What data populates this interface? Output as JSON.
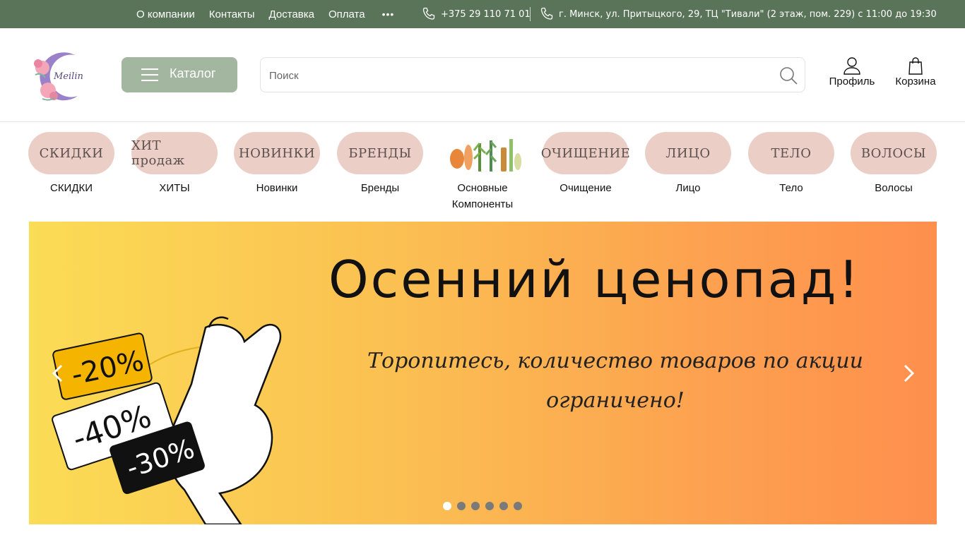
{
  "topbar": {
    "links": [
      "О компании",
      "Контакты",
      "Доставка",
      "Оплата"
    ],
    "more": "•••",
    "phone": "+375 29 110 71 01",
    "address": "г. Минск, ул. Притыцкого, 29, ТЦ \"Тивали\" (2 этаж, пом. 229) с 11:00 до 19:30"
  },
  "header": {
    "logo_text": "Meilin",
    "catalog_label": "Каталог",
    "search_placeholder": "Поиск",
    "profile_label": "Профиль",
    "cart_label": "Корзина"
  },
  "categories": [
    {
      "pill": "СКИДКИ",
      "caption": "СКИДКИ"
    },
    {
      "pill": "ХИТ продаж",
      "caption": "ХИТЫ"
    },
    {
      "pill": "НОВИНКИ",
      "caption": "Новинки"
    },
    {
      "pill": "БРЕНДЫ",
      "caption": "Бренды"
    },
    {
      "pill": "",
      "caption": "Основные Компоненты",
      "image": "ingredients-image"
    },
    {
      "pill": "ОЧИЩЕНИЕ",
      "caption": "Очищение"
    },
    {
      "pill": "ЛИЦО",
      "caption": "Лицо"
    },
    {
      "pill": "ТЕЛО",
      "caption": "Тело"
    },
    {
      "pill": "ВОЛОСЫ",
      "caption": "Волосы"
    }
  ],
  "banner": {
    "title": "Осенний ценопад!",
    "subtitle": "Торопитесь, количество товаров по акции ограничено!",
    "tags": [
      "-20%",
      "-40%",
      "-30%"
    ],
    "slide_count": 6,
    "active_slide": 1
  },
  "colors": {
    "topbar_bg": "#5a7459",
    "catalog_bg": "#a3b6a0",
    "pill_bg": "#ebcfc7",
    "banner_start": "#fbdc55",
    "banner_end": "#fe8f4d"
  }
}
